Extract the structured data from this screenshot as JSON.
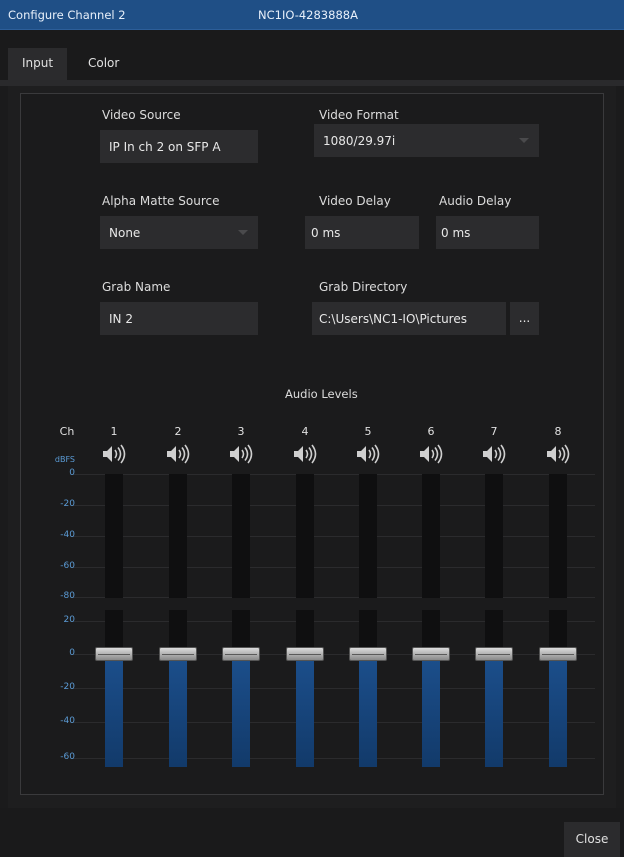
{
  "window": {
    "title": "Configure Channel 2",
    "device": "NC1IO-4283888A"
  },
  "tabs": [
    {
      "label": "Input",
      "active": true
    },
    {
      "label": "Color",
      "active": false
    }
  ],
  "form": {
    "video_source_label": "Video Source",
    "video_source_value": "IP In ch 2 on SFP A",
    "video_format_label": "Video Format",
    "video_format_value": "1080/29.97i",
    "alpha_label": "Alpha Matte Source",
    "alpha_value": "None",
    "video_delay_label": "Video Delay",
    "video_delay_value": "0 ms",
    "audio_delay_label": "Audio Delay",
    "audio_delay_value": "0 ms",
    "grab_name_label": "Grab Name",
    "grab_name_value": "IN 2",
    "grab_dir_label": "Grab Directory",
    "grab_dir_value": "C:\\Users\\NC1-IO\\Pictures",
    "browse_label": "..."
  },
  "audio": {
    "title": "Audio Levels",
    "ch_label": "Ch",
    "dbfs_label": "dBFS",
    "channels": [
      "1",
      "2",
      "3",
      "4",
      "5",
      "6",
      "7",
      "8"
    ],
    "meter_scale": [
      "0",
      "-20",
      "-40",
      "-60",
      "-80"
    ],
    "fader_scale": [
      "20",
      "0",
      "-20",
      "-40",
      "-60"
    ],
    "fader_levels_db": [
      0,
      0,
      0,
      0,
      0,
      0,
      0,
      0
    ],
    "accent_color": "#5b9bd5"
  },
  "footer": {
    "close_label": "Close"
  }
}
